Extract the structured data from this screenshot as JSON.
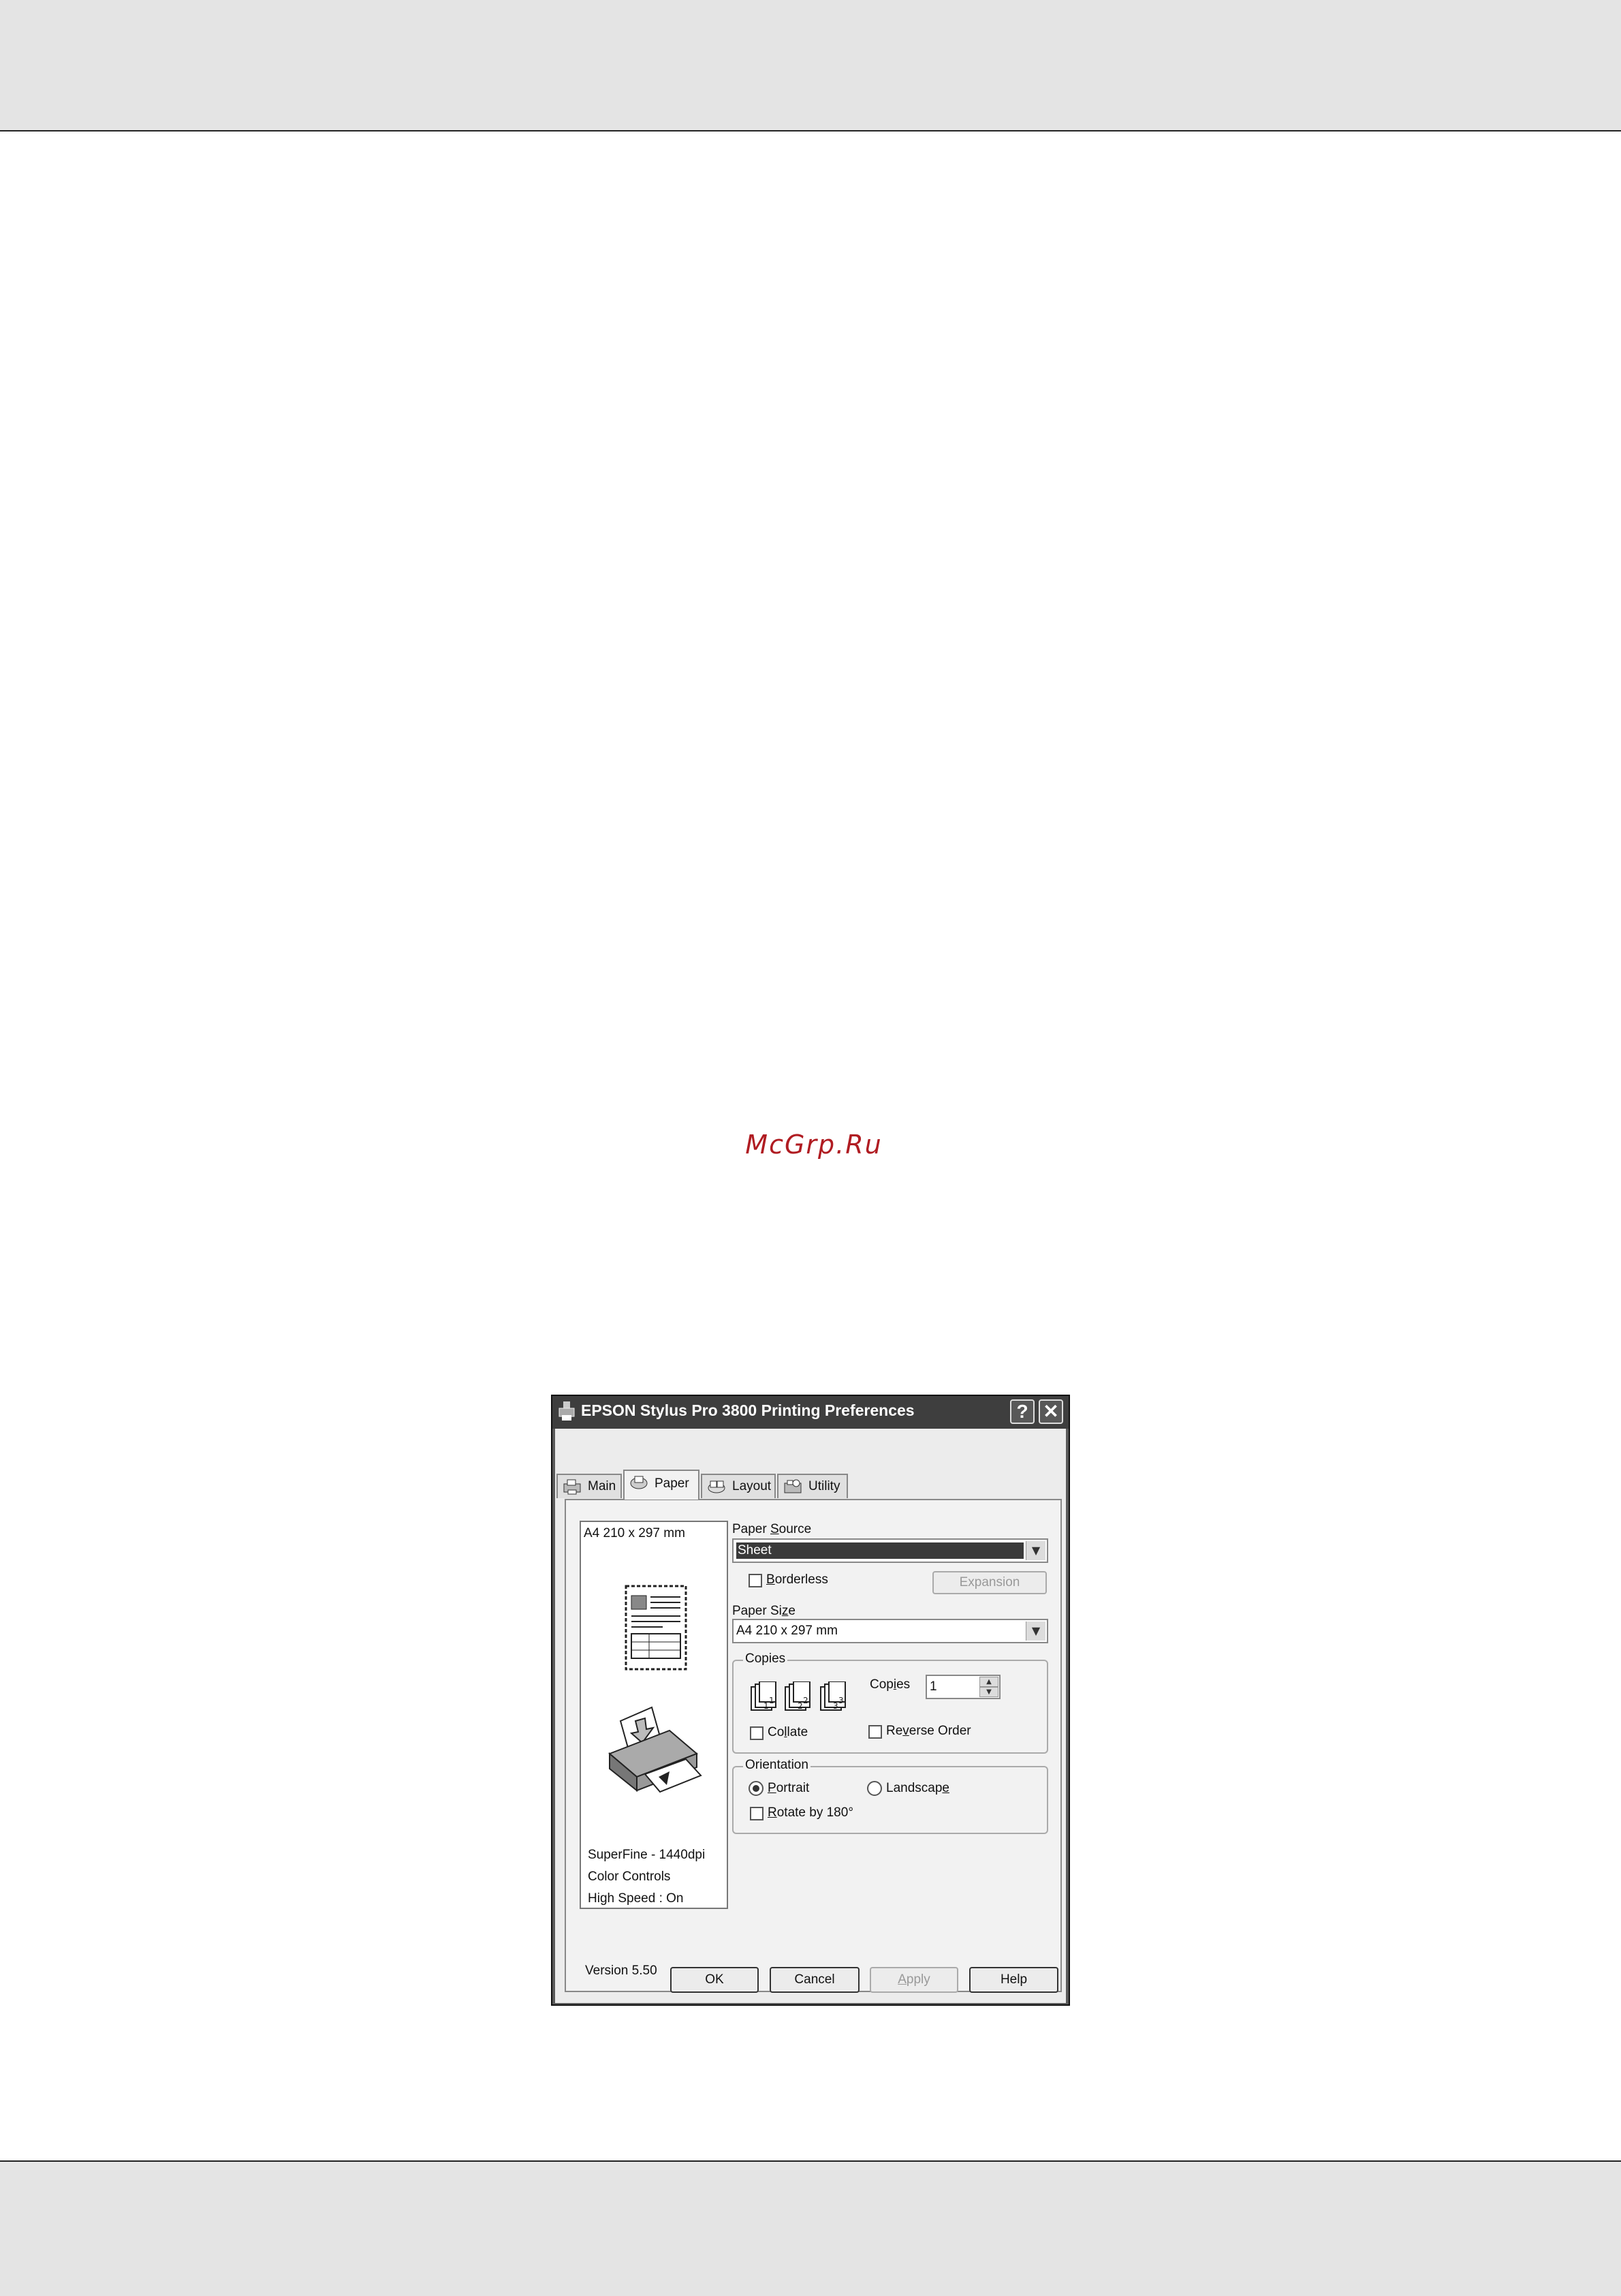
{
  "watermark": "McGrp.Ru",
  "window": {
    "title": "EPSON Stylus Pro 3800 Printing Preferences",
    "help_button": "?",
    "close_button": "✕"
  },
  "tabs": [
    {
      "label": "Main"
    },
    {
      "label": "Paper"
    },
    {
      "label": "Layout"
    },
    {
      "label": "Utility"
    }
  ],
  "preview": {
    "paper_label": "A4 210 x 297 mm",
    "info_lines": [
      "SuperFine - 1440dpi",
      "Color Controls",
      "High Speed : On"
    ]
  },
  "paper_source": {
    "label_pre": "Paper ",
    "label_u": "S",
    "label_post": "ource",
    "value": "Sheet"
  },
  "borderless": {
    "label_u": "B",
    "label_post": "orderless",
    "checked": false
  },
  "expansion_button": "Expansion",
  "paper_size": {
    "label_pre": "Paper Si",
    "label_u": "z",
    "label_post": "e",
    "value": "A4 210 x 297 mm"
  },
  "copies_group": {
    "title": "Copies",
    "copies_label_pre": "Cop",
    "copies_label_u": "i",
    "copies_label_post": "es",
    "copies_value": "1",
    "collate_pre": "Co",
    "collate_u": "l",
    "collate_post": "late",
    "reverse_pre": "Re",
    "reverse_u": "v",
    "reverse_post": "erse Order"
  },
  "orientation_group": {
    "title": "Orientation",
    "portrait_u": "P",
    "portrait_post": "ortrait",
    "landscape_pre": "Landscap",
    "landscape_u": "e",
    "landscape_post": "",
    "selected": "Portrait",
    "rotate_u": "R",
    "rotate_post": "otate by 180°"
  },
  "version": "Version 5.50",
  "buttons": {
    "ok": "OK",
    "cancel": "Cancel",
    "apply_u": "A",
    "apply_post": "pply",
    "help": "Help"
  }
}
